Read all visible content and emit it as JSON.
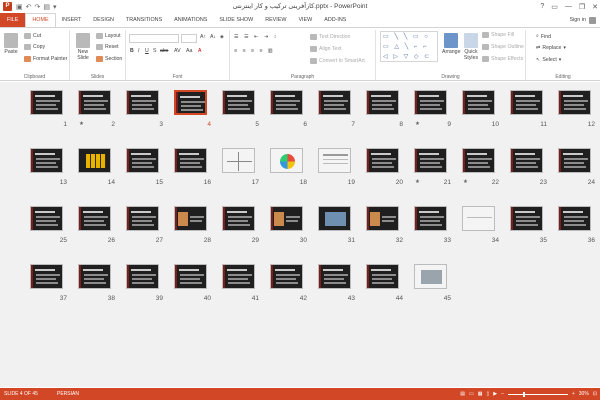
{
  "window": {
    "title": "کارآفرینی ترکیب و کار اینترنتی.pptx - PowerPoint",
    "minimize": "—",
    "restore": "❐",
    "close": "✕",
    "help": "?"
  },
  "tabs": [
    "FILE",
    "HOME",
    "INSERT",
    "DESIGN",
    "TRANSITIONS",
    "ANIMATIONS",
    "SLIDE SHOW",
    "REVIEW",
    "VIEW",
    "ADD-INS"
  ],
  "active_tab": "HOME",
  "signin": "Sign in",
  "ribbon": {
    "clipboard": {
      "paste": "Paste",
      "cut": "Cut",
      "copy": "Copy",
      "format_painter": "Format Painter",
      "label": "Clipboard"
    },
    "slides": {
      "new_slide": "New Slide",
      "layout": "Layout",
      "reset": "Reset",
      "section": "Section",
      "label": "Slides"
    },
    "font": {
      "label": "Font",
      "bold": "B",
      "italic": "I",
      "underline": "U",
      "strike": "S",
      "shadow": "abc",
      "spacing": "AV",
      "case": "Aa",
      "color": "A"
    },
    "paragraph": {
      "text_direction": "Text Direction",
      "align_text": "Align Text",
      "convert": "Convert to SmartArt",
      "label": "Paragraph"
    },
    "drawing": {
      "arrange": "Arrange",
      "quick_styles": "Quick Styles",
      "shape_fill": "Shape Fill",
      "shape_outline": "Shape Outline",
      "shape_effects": "Shape Effects",
      "label": "Drawing",
      "shapes_glyphs": "▭ ╲ ╲ ▭ ○ ▭ △ ╲ ⌐ ⌐ ◁ ▷ ▽ ◇ ⊂ { } ☆"
    },
    "editing": {
      "find": "Find",
      "replace": "Replace",
      "select": "Select",
      "label": "Editing"
    }
  },
  "slides": [
    {
      "n": "12"
    },
    {
      "n": "11"
    },
    {
      "n": "10"
    },
    {
      "n": "9",
      "star": true
    },
    {
      "n": "8"
    },
    {
      "n": "7"
    },
    {
      "n": "6"
    },
    {
      "n": "5"
    },
    {
      "n": "4",
      "selected": true
    },
    {
      "n": "3"
    },
    {
      "n": "2",
      "star": true
    },
    {
      "n": "1"
    },
    {
      "n": "24"
    },
    {
      "n": "23"
    },
    {
      "n": "22",
      "star": true
    },
    {
      "n": "21",
      "star": true
    },
    {
      "n": "20"
    },
    {
      "n": "19"
    },
    {
      "n": "18"
    },
    {
      "n": "17"
    },
    {
      "n": "16"
    },
    {
      "n": "15"
    },
    {
      "n": "14"
    },
    {
      "n": "13"
    },
    {
      "n": "36"
    },
    {
      "n": "35"
    },
    {
      "n": "34"
    },
    {
      "n": "33"
    },
    {
      "n": "32"
    },
    {
      "n": "31"
    },
    {
      "n": "30"
    },
    {
      "n": "29"
    },
    {
      "n": "28"
    },
    {
      "n": "27"
    },
    {
      "n": "26"
    },
    {
      "n": "25"
    },
    {
      "n": "45"
    },
    {
      "n": "44"
    },
    {
      "n": "43"
    },
    {
      "n": "42"
    },
    {
      "n": "41"
    },
    {
      "n": "40"
    },
    {
      "n": "39"
    },
    {
      "n": "38"
    },
    {
      "n": "37"
    }
  ],
  "status": {
    "slide_info": "SLIDE 4 OF 45",
    "language": "PERSIAN",
    "zoom": "30%",
    "zoom_minus": "–",
    "zoom_plus": "+"
  },
  "colors": {
    "accent": "#d24726"
  }
}
